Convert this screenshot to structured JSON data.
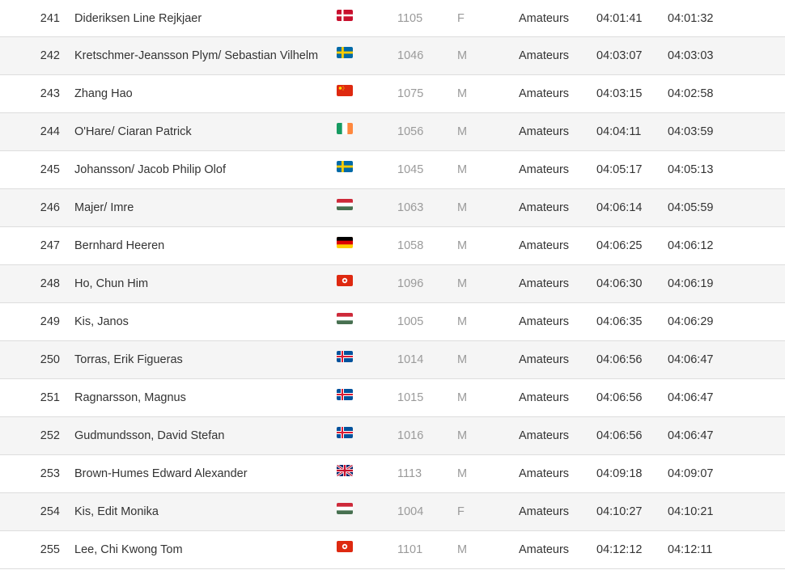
{
  "results": [
    {
      "rank": "241",
      "name": "Dideriksen Line Rejkjaer",
      "flag": "flag-denmark",
      "bib": "1105",
      "sex": "F",
      "category": "Amateurs",
      "gun_time": "04:01:41",
      "chip_time": "04:01:32"
    },
    {
      "rank": "242",
      "name": "Kretschmer-Jeansson Plym/ Sebastian Vilhelm",
      "flag": "flag-sweden",
      "bib": "1046",
      "sex": "M",
      "category": "Amateurs",
      "gun_time": "04:03:07",
      "chip_time": "04:03:03"
    },
    {
      "rank": "243",
      "name": "Zhang Hao",
      "flag": "flag-china",
      "bib": "1075",
      "sex": "M",
      "category": "Amateurs",
      "gun_time": "04:03:15",
      "chip_time": "04:02:58"
    },
    {
      "rank": "244",
      "name": "O'Hare/ Ciaran Patrick",
      "flag": "flag-ireland",
      "bib": "1056",
      "sex": "M",
      "category": "Amateurs",
      "gun_time": "04:04:11",
      "chip_time": "04:03:59"
    },
    {
      "rank": "245",
      "name": "Johansson/ Jacob Philip Olof",
      "flag": "flag-sweden",
      "bib": "1045",
      "sex": "M",
      "category": "Amateurs",
      "gun_time": "04:05:17",
      "chip_time": "04:05:13"
    },
    {
      "rank": "246",
      "name": "Majer/ Imre",
      "flag": "flag-hungary",
      "bib": "1063",
      "sex": "M",
      "category": "Amateurs",
      "gun_time": "04:06:14",
      "chip_time": "04:05:59"
    },
    {
      "rank": "247",
      "name": "Bernhard Heeren",
      "flag": "flag-germany",
      "bib": "1058",
      "sex": "M",
      "category": "Amateurs",
      "gun_time": "04:06:25",
      "chip_time": "04:06:12"
    },
    {
      "rank": "248",
      "name": "Ho, Chun Him",
      "flag": "flag-hong-kong",
      "bib": "1096",
      "sex": "M",
      "category": "Amateurs",
      "gun_time": "04:06:30",
      "chip_time": "04:06:19"
    },
    {
      "rank": "249",
      "name": "Kis, Janos",
      "flag": "flag-hungary",
      "bib": "1005",
      "sex": "M",
      "category": "Amateurs",
      "gun_time": "04:06:35",
      "chip_time": "04:06:29"
    },
    {
      "rank": "250",
      "name": "Torras, Erik Figueras",
      "flag": "flag-iceland",
      "bib": "1014",
      "sex": "M",
      "category": "Amateurs",
      "gun_time": "04:06:56",
      "chip_time": "04:06:47"
    },
    {
      "rank": "251",
      "name": "Ragnarsson, Magnus",
      "flag": "flag-iceland",
      "bib": "1015",
      "sex": "M",
      "category": "Amateurs",
      "gun_time": "04:06:56",
      "chip_time": "04:06:47"
    },
    {
      "rank": "252",
      "name": "Gudmundsson, David Stefan",
      "flag": "flag-iceland",
      "bib": "1016",
      "sex": "M",
      "category": "Amateurs",
      "gun_time": "04:06:56",
      "chip_time": "04:06:47"
    },
    {
      "rank": "253",
      "name": "Brown-Humes Edward Alexander",
      "flag": "flag-united-kingdom",
      "bib": "1113",
      "sex": "M",
      "category": "Amateurs",
      "gun_time": "04:09:18",
      "chip_time": "04:09:07"
    },
    {
      "rank": "254",
      "name": "Kis, Edit Monika",
      "flag": "flag-hungary",
      "bib": "1004",
      "sex": "F",
      "category": "Amateurs",
      "gun_time": "04:10:27",
      "chip_time": "04:10:21"
    },
    {
      "rank": "255",
      "name": "Lee, Chi Kwong Tom",
      "flag": "flag-hong-kong",
      "bib": "1101",
      "sex": "M",
      "category": "Amateurs",
      "gun_time": "04:12:12",
      "chip_time": "04:12:11"
    }
  ],
  "colors": {
    "row_even_bg": "#f5f5f5",
    "row_odd_bg": "#ffffff",
    "divider": "#dddddd",
    "text": "#333333",
    "muted_text": "#9a9a9a"
  }
}
